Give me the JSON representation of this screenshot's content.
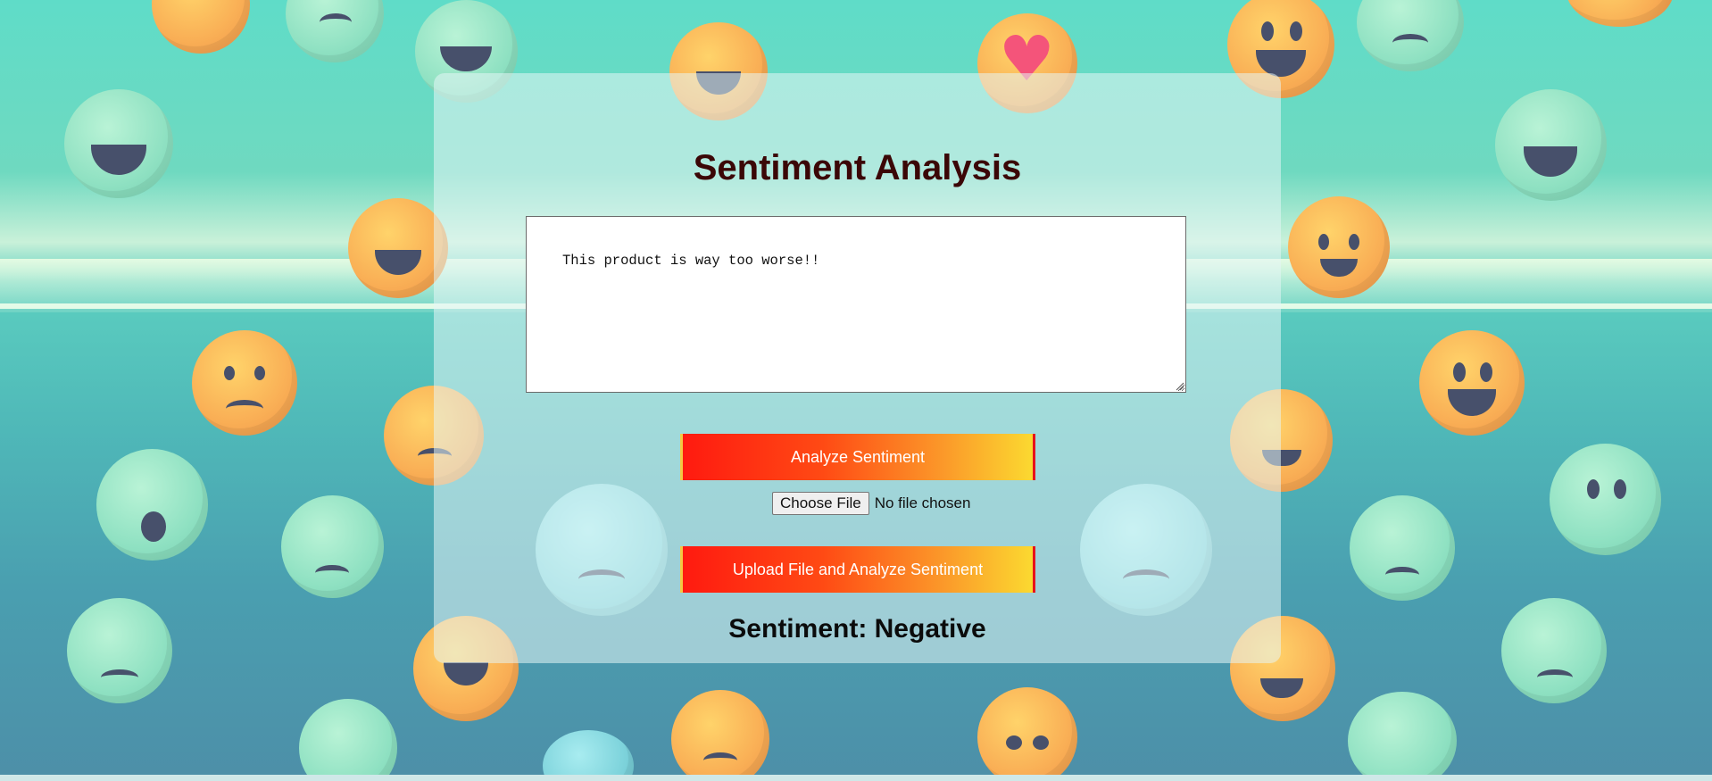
{
  "page": {
    "title": "Sentiment Analysis"
  },
  "input": {
    "text_value": "This product is way too worse!!"
  },
  "buttons": {
    "analyze_label": "Analyze Sentiment",
    "upload_label": "Upload File and Analyze Sentiment"
  },
  "file_input": {
    "choose_label": "Choose File",
    "status_text": "No file chosen"
  },
  "result": {
    "text": "Sentiment: Negative"
  },
  "colors": {
    "title": "#3b0707",
    "button_gradient_start": "#ff1a10",
    "button_gradient_end": "#fbd930",
    "background_teal": "#5fdcc8"
  },
  "background": {
    "icon_names": [
      "smiley-face-icon",
      "frowning-face-icon",
      "angry-face-icon",
      "surprised-face-icon",
      "heart-icon",
      "winking-face-icon"
    ]
  }
}
